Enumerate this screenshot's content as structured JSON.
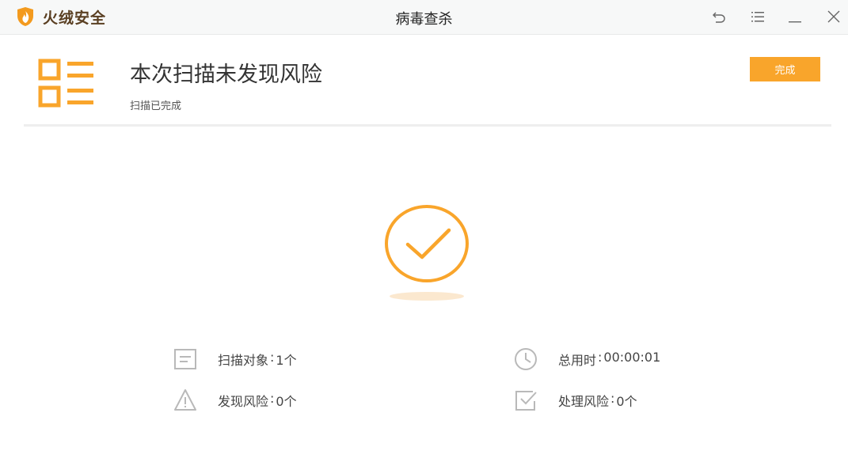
{
  "app": {
    "brand_name": "火绒安全",
    "window_title": "病毒查杀"
  },
  "header": {
    "title": "本次扫描未发现风险",
    "subtitle": "扫描已完成",
    "done_label": "完成"
  },
  "stats": {
    "scan_objects": {
      "label": "扫描对象",
      "value": "1个"
    },
    "total_time": {
      "label": "总用时",
      "value": "00:00:01"
    },
    "risks_found": {
      "label": "发现风险",
      "value": "0个"
    },
    "risks_handled": {
      "label": "处理风险",
      "value": "0个"
    },
    "separator": ":"
  },
  "icons": {
    "brand": "huorong-flame-logo",
    "back": "back-arrow-icon",
    "menu": "menu-icon",
    "minimize": "minimize-icon",
    "close": "close-icon",
    "report": "report-list-icon",
    "check": "check-circle-icon",
    "document": "document-icon",
    "clock": "clock-icon",
    "warning": "warning-icon",
    "checkbox": "checkbox-icon"
  },
  "colors": {
    "accent": "#f9a52b",
    "brand_text": "#5a3f22",
    "icon_gray": "#b9b9b9"
  }
}
